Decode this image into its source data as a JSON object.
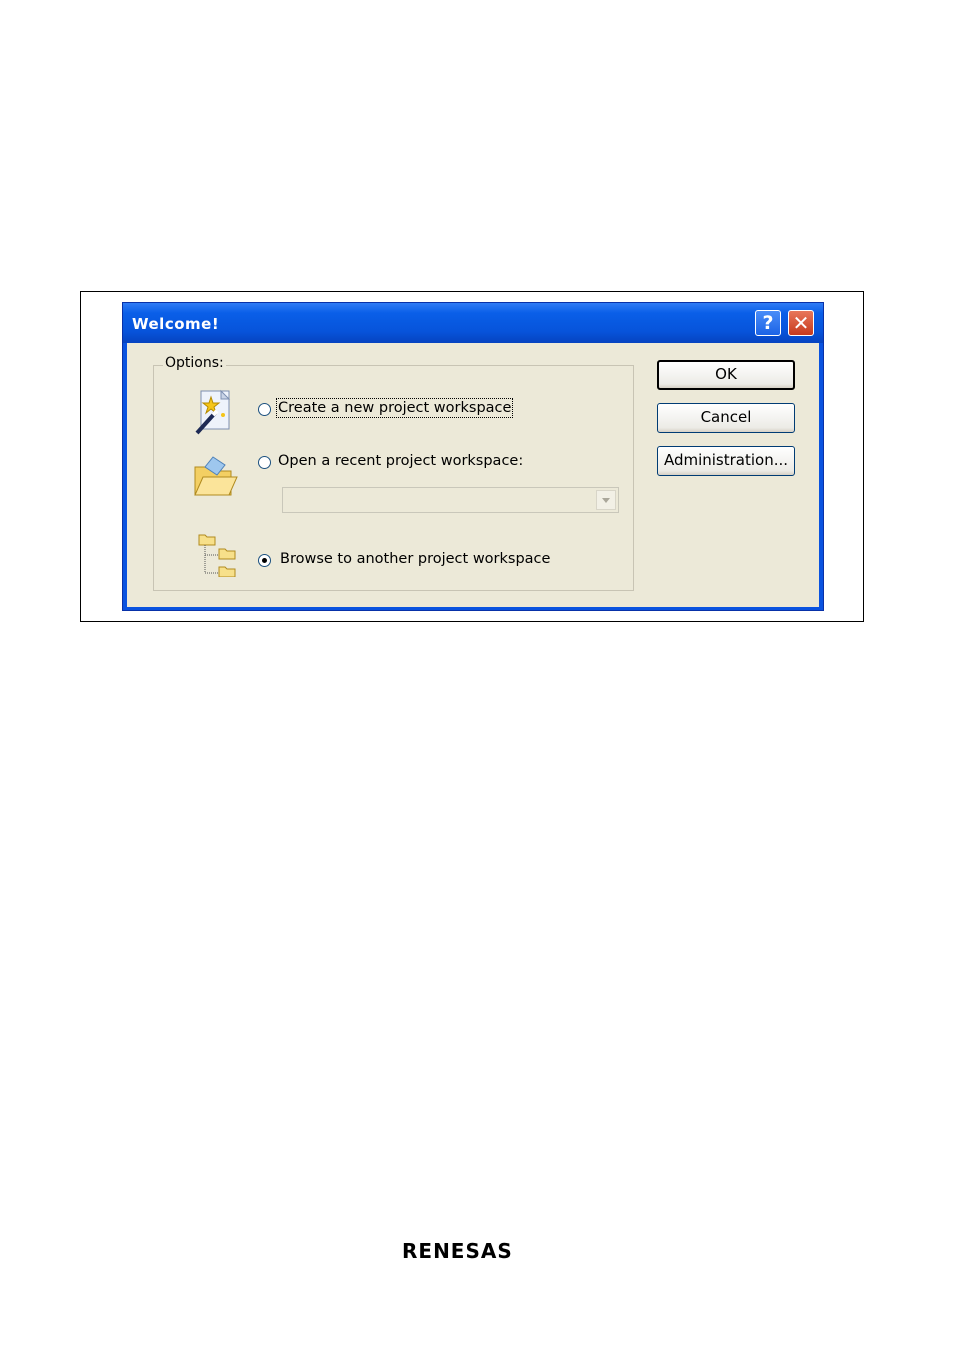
{
  "dialog": {
    "title": "Welcome!",
    "help_button": "?",
    "close_button": "✕"
  },
  "options": {
    "group_label": "Options:",
    "create_label": "Create a new project workspace",
    "create_selected": false,
    "open_label": "Open a recent project workspace:",
    "open_selected": false,
    "recent_combo_value": "",
    "browse_label": "Browse to another project workspace",
    "browse_selected": true
  },
  "buttons": {
    "ok": "OK",
    "cancel": "Cancel",
    "administration": "Administration..."
  },
  "footer": {
    "logo_text": "RENESAS"
  },
  "colors": {
    "titlebar": "#0a53e0",
    "dialog_face": "#ece9d8",
    "close_button": "#c73a1d"
  }
}
